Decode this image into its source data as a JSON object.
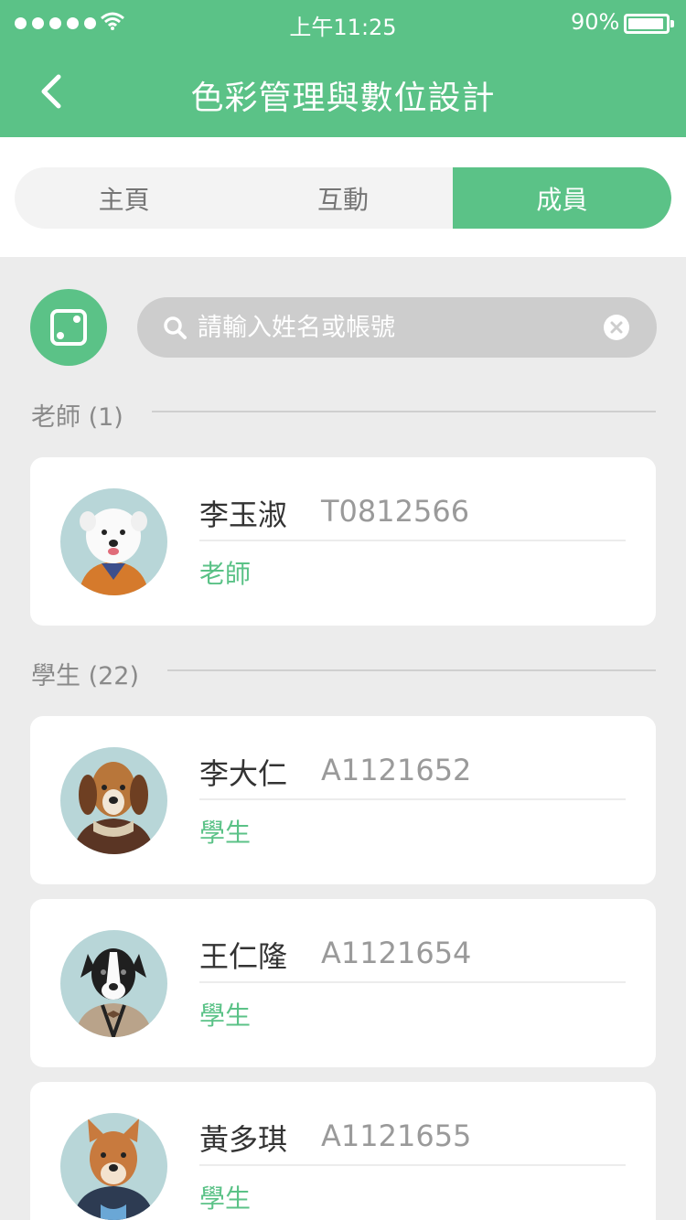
{
  "status_bar": {
    "time": "上午11:25",
    "battery": "90%"
  },
  "header": {
    "title": "色彩管理與數位設計"
  },
  "tabs": [
    {
      "label": "主頁",
      "active": false
    },
    {
      "label": "互動",
      "active": false
    },
    {
      "label": "成員",
      "active": true
    }
  ],
  "search": {
    "placeholder": "請輸入姓名或帳號",
    "value": ""
  },
  "teachers": {
    "heading": "老師 (1)",
    "members": [
      {
        "name": "李玉淑",
        "id": "T0812566",
        "role": "老師",
        "avatar_icon": "dog-avatar-white"
      }
    ]
  },
  "students": {
    "heading": "學生 (22)",
    "members": [
      {
        "name": "李大仁",
        "id": "A1121652",
        "role": "學生",
        "avatar_icon": "dog-avatar-beagle"
      },
      {
        "name": "王仁隆",
        "id": "A1121654",
        "role": "學生",
        "avatar_icon": "dog-avatar-bw"
      },
      {
        "name": "黃多琪",
        "id": "A1121655",
        "role": "學生",
        "avatar_icon": "dog-avatar-shiba"
      }
    ]
  },
  "colors": {
    "accent": "#5bc287",
    "page_bg": "#ececec",
    "search_bg": "#cdcdcd",
    "avatar_bg": "#b8d6d8"
  }
}
